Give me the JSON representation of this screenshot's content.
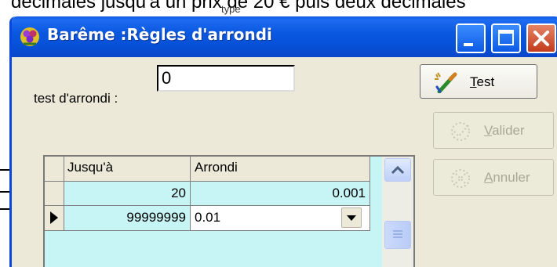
{
  "background": {
    "caption_text": "décimales jusqu'à un prix de 20 € puis deux décimales",
    "fragment_text": "type"
  },
  "window": {
    "title": "Barême :Règles d'arrondi"
  },
  "form": {
    "test_label": "test d'arrondi :",
    "test_value": "0"
  },
  "buttons": {
    "test": {
      "prefix": "",
      "mnemonic": "T",
      "rest": "est"
    },
    "valider": {
      "prefix": "",
      "mnemonic": "V",
      "rest": "alider"
    },
    "annuler": {
      "prefix": "",
      "mnemonic": "A",
      "rest": "nnuler"
    }
  },
  "grid": {
    "columns": [
      "Jusqu'à",
      "Arrondi"
    ],
    "rows": [
      {
        "upto": "20",
        "rounding": "0.001",
        "current": false
      },
      {
        "upto": "99999999",
        "rounding": "0.01",
        "current": true
      }
    ]
  },
  "colors": {
    "titlebar": "#0a58e0",
    "grid_background": "#c7f4f4",
    "window_background": "#ece9d8",
    "close_button": "#c43a1c"
  },
  "icons": [
    "app-icon",
    "minimize-icon",
    "maximize-icon",
    "close-icon",
    "pencil-magic-icon",
    "check-sparkle-icon",
    "cancel-sparkle-icon",
    "current-row-indicator-icon",
    "dropdown-arrow-icon",
    "scroll-up-icon",
    "scroll-grip-icon"
  ]
}
